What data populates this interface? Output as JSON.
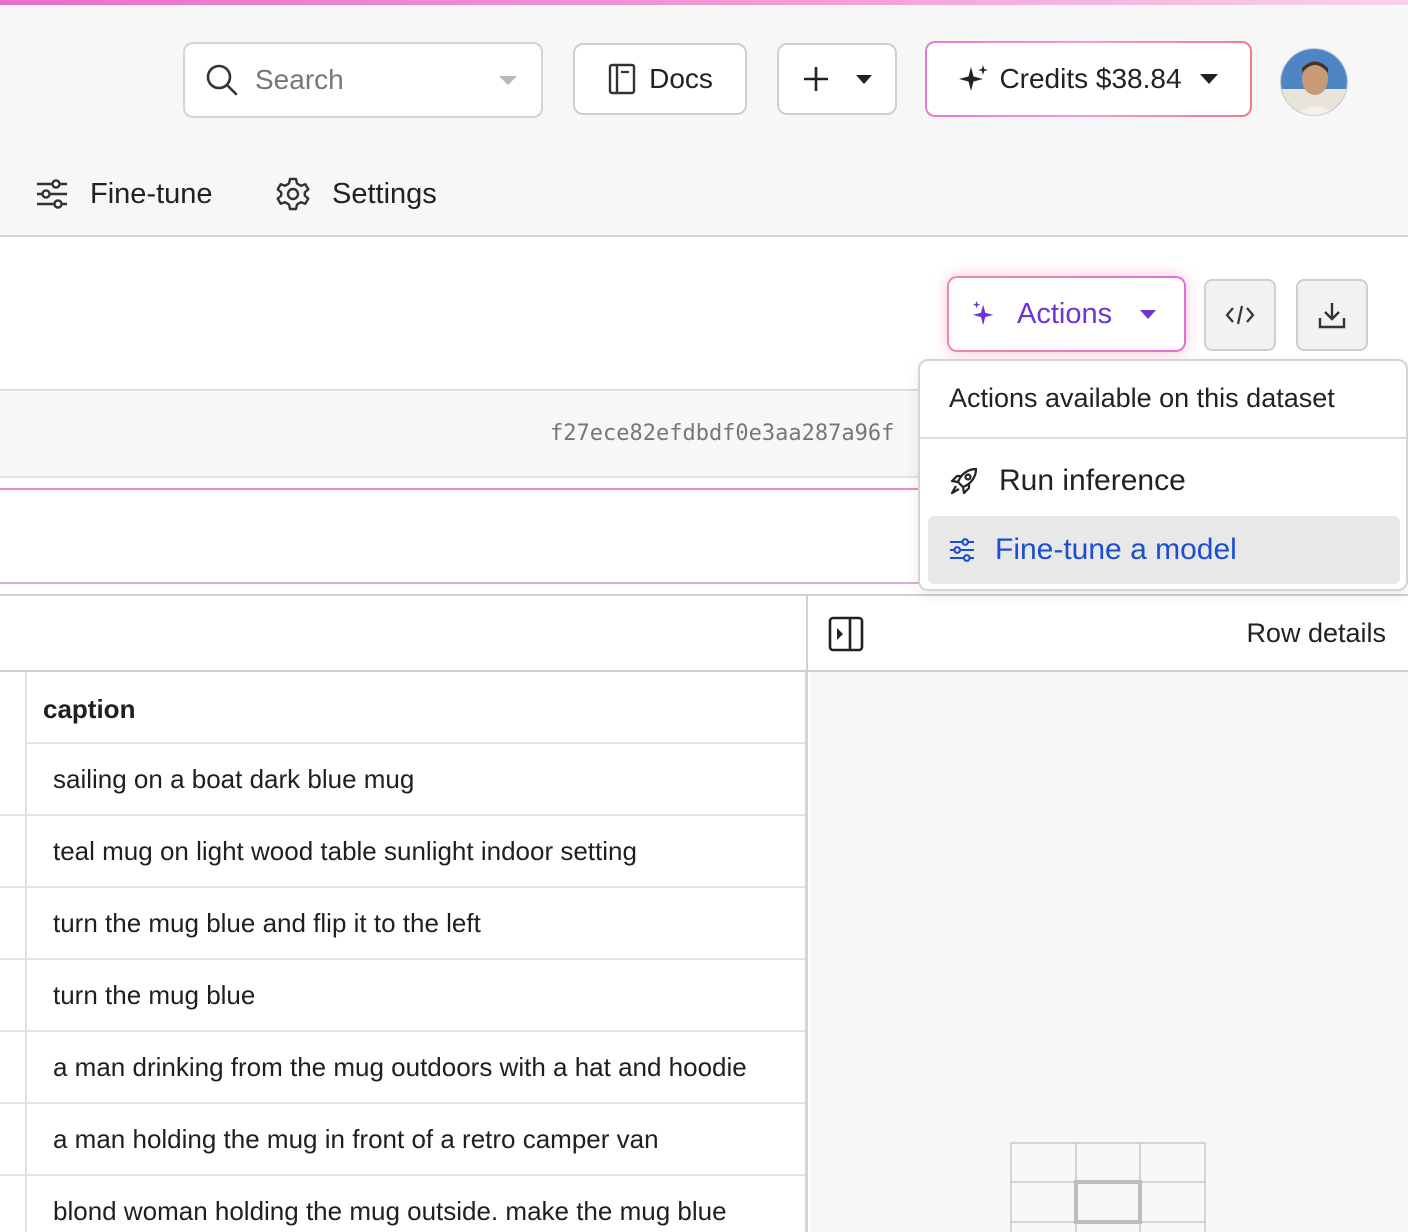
{
  "header": {
    "search": {
      "placeholder": "Search"
    },
    "docs_label": "Docs",
    "credits_label": "Credits $38.84",
    "colors": {
      "credits_border": "#e77ad0",
      "top_accent": "#e86fc8"
    }
  },
  "nav": {
    "items": [
      {
        "label": "Fine-tune",
        "icon": "sliders-icon"
      },
      {
        "label": "Settings",
        "icon": "gear-icon"
      }
    ]
  },
  "toolbar": {
    "actions_label": "Actions",
    "actions_color": "#6d35d6"
  },
  "dataset": {
    "hash": "f27ece82efdbdf0e3aa287a96f"
  },
  "actions_menu": {
    "header": "Actions available on this dataset",
    "items": [
      {
        "label": "Run inference",
        "icon": "rocket-icon",
        "highlighted": false
      },
      {
        "label": "Fine-tune a model",
        "icon": "sliders-icon",
        "highlighted": true
      }
    ],
    "highlight_color": "#1b4fd0"
  },
  "table": {
    "column_header": "caption",
    "rows": [
      "sailing on a boat dark blue mug",
      "teal mug on light wood table sunlight indoor setting",
      "turn the mug blue and flip it to the left",
      "turn the mug blue",
      "a man drinking from the mug outdoors with a hat and hoodie",
      "a man holding the mug in front of a retro camper van",
      "blond woman holding the mug outside. make the mug blue"
    ]
  },
  "details": {
    "label": "Row details"
  }
}
